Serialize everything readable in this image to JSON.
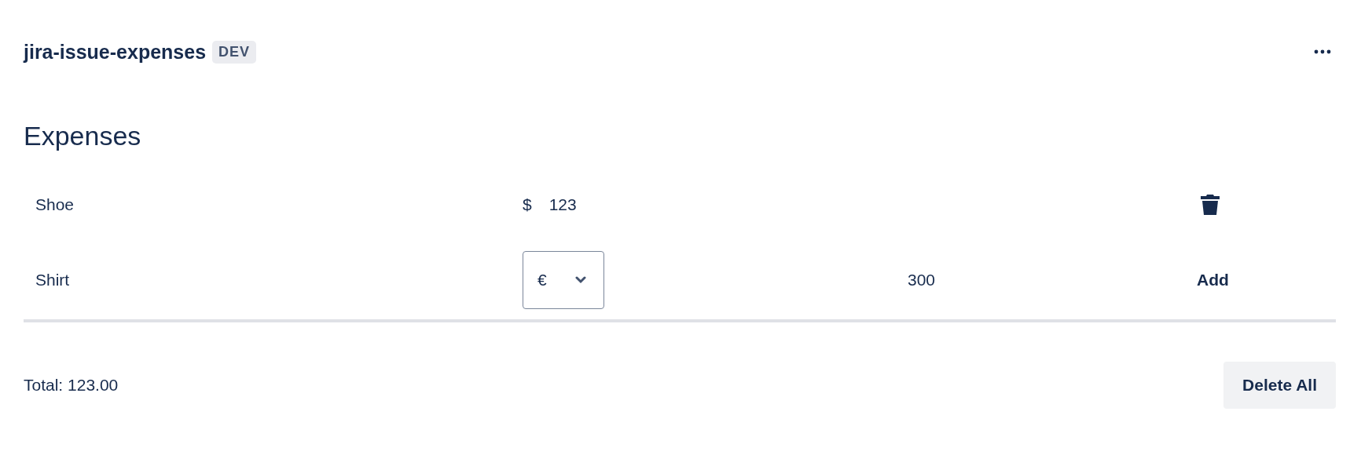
{
  "header": {
    "title": "jira-issue-expenses",
    "badge": "DEV"
  },
  "heading": "Expenses",
  "rows": [
    {
      "kind": "saved",
      "name": "Shoe",
      "currency": "$",
      "amount": "123"
    },
    {
      "kind": "new",
      "name": "Shirt",
      "currency": "€",
      "amount": "300",
      "action": "Add"
    }
  ],
  "total": "Total: 123.00",
  "delete_all": "Delete All"
}
